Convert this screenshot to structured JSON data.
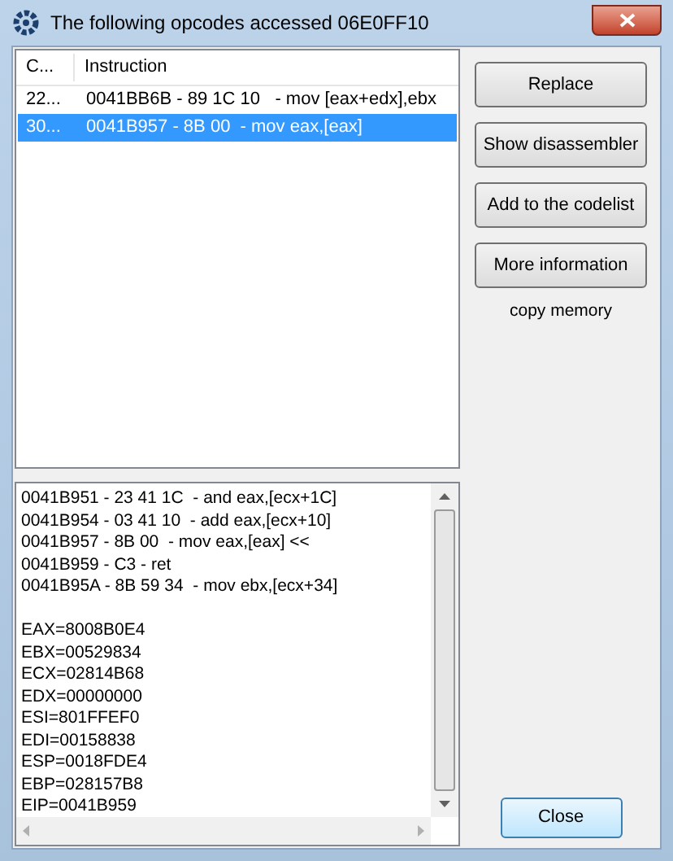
{
  "window": {
    "title": "The following opcodes accessed 06E0FF10"
  },
  "table": {
    "columns": [
      "C...",
      "Instruction"
    ],
    "rows": [
      {
        "count": "22...",
        "instruction": "0041BB6B - 89 1C 10   - mov [eax+edx],ebx",
        "selected": false
      },
      {
        "count": "30...",
        "instruction": "0041B957 - 8B 00  - mov eax,[eax]",
        "selected": true
      }
    ]
  },
  "disassembly": [
    "0041B951 - 23 41 1C  - and eax,[ecx+1C]",
    "0041B954 - 03 41 10  - add eax,[ecx+10]",
    "0041B957 - 8B 00  - mov eax,[eax] <<",
    "0041B959 - C3 - ret",
    "0041B95A - 8B 59 34  - mov ebx,[ecx+34]"
  ],
  "registers": [
    "EAX=8008B0E4",
    "EBX=00529834",
    "ECX=02814B68",
    "EDX=00000000",
    "ESI=801FFEF0",
    "EDI=00158838",
    "ESP=0018FDE4",
    "EBP=028157B8",
    "EIP=0041B959"
  ],
  "buttons": [
    "Replace",
    "Show disassembler",
    "Add to the codelist",
    "More information"
  ],
  "copy_memory": "copy memory",
  "close_button": "Close"
}
